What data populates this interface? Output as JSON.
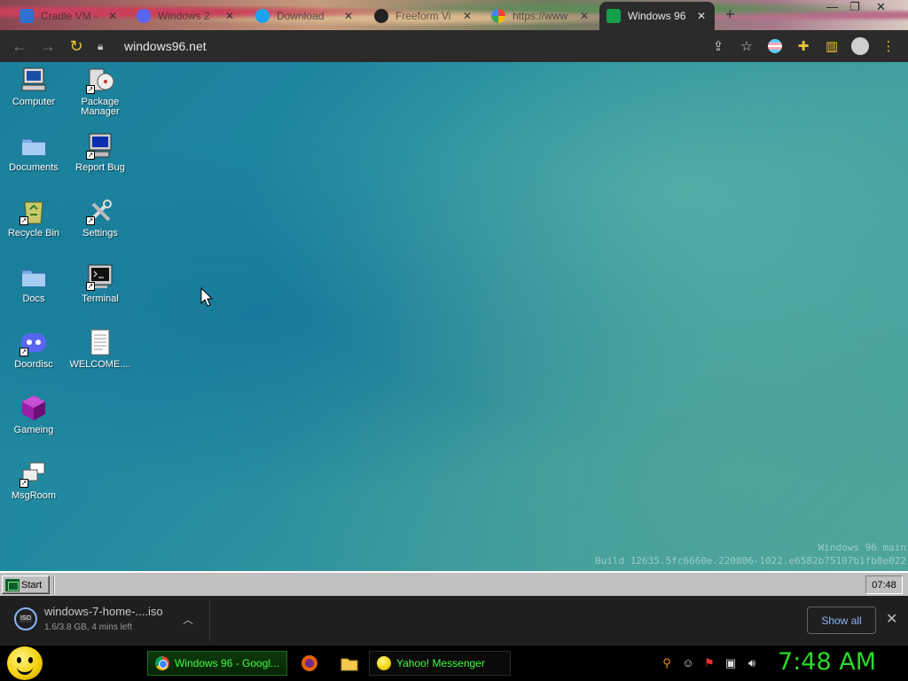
{
  "browser": {
    "tabs": [
      {
        "title": "Cradle VM - ",
        "icon": "chart-icon",
        "active": false
      },
      {
        "title": "Windows 2",
        "icon": "discord-icon",
        "active": false
      },
      {
        "title": "Download",
        "icon": "bird-icon",
        "active": false
      },
      {
        "title": "Freeform Vi",
        "icon": "moth-icon",
        "active": false
      },
      {
        "title": "https://www",
        "icon": "google-icon",
        "active": false
      },
      {
        "title": "Windows 96",
        "icon": "win96-icon",
        "active": true
      }
    ],
    "new_tab": "+",
    "url": "windows96.net"
  },
  "desktop": {
    "icons": [
      {
        "label": "Computer",
        "icon": "computer-icon"
      },
      {
        "label": "Package Manager",
        "icon": "package-manager-icon"
      },
      {
        "label": "Documents",
        "icon": "folder-icon"
      },
      {
        "label": "Report Bug",
        "icon": "report-bug-icon"
      },
      {
        "label": "Recycle Bin",
        "icon": "recycle-bin-icon"
      },
      {
        "label": "Settings",
        "icon": "settings-icon"
      },
      {
        "label": "Docs",
        "icon": "folder-icon"
      },
      {
        "label": "Terminal",
        "icon": "terminal-icon"
      },
      {
        "label": "Doordisc",
        "icon": "doordisc-icon"
      },
      {
        "label": "WELCOME....",
        "icon": "text-file-icon"
      },
      {
        "label": "Gameing",
        "icon": "cube-icon"
      },
      {
        "label": "MsgRoom",
        "icon": "msgroom-icon"
      }
    ],
    "build_line1": "Windows 96 main",
    "build_line2": "Build 12635.5fc6660e.220806-1022.e6582b75107b1fb8e022"
  },
  "w96_taskbar": {
    "start_label": "Start",
    "clock": "07:48"
  },
  "download_shelf": {
    "file_badge": "ISO",
    "filename": "windows-7-home-....iso",
    "status": "1.6/3.8 GB, 4 mins left",
    "show_all": "Show all"
  },
  "host_taskbar": {
    "tasks": [
      {
        "label": "Windows 96 - Googl...",
        "icon": "chrome-icon"
      },
      {
        "label": "Yahoo! Messenger",
        "icon": "yahoo-messenger-icon"
      }
    ],
    "clock": "7:48 AM"
  },
  "colors": {
    "clock_green": "#2bd82b",
    "task_green": "#3cff3c",
    "link_blue": "#8ab4f8",
    "win96_grey": "#c0c0c0"
  }
}
